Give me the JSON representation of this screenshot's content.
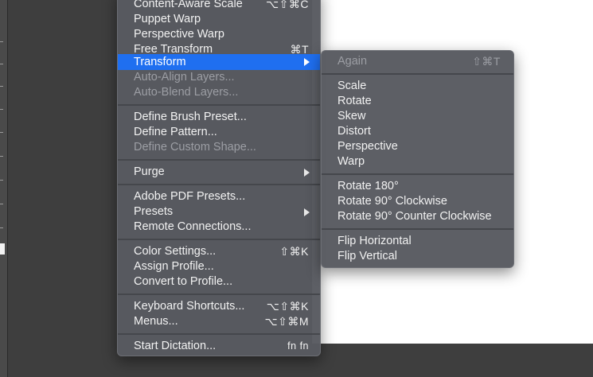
{
  "main_menu": {
    "items": [
      {
        "label": "Content-Aware Scale",
        "shortcut": "⌥⇧⌘C"
      },
      {
        "label": "Puppet Warp",
        "shortcut": ""
      },
      {
        "label": "Perspective Warp",
        "shortcut": ""
      },
      {
        "label": "Free Transform",
        "shortcut": "⌘T"
      },
      {
        "label": "Transform",
        "shortcut": "",
        "submenu": true,
        "highlighted": true
      },
      {
        "label": "Auto-Align Layers...",
        "shortcut": "",
        "disabled": true
      },
      {
        "label": "Auto-Blend Layers...",
        "shortcut": "",
        "disabled": true
      },
      {
        "label": "Define Brush Preset...",
        "shortcut": ""
      },
      {
        "label": "Define Pattern...",
        "shortcut": ""
      },
      {
        "label": "Define Custom Shape...",
        "shortcut": "",
        "disabled": true
      },
      {
        "label": "Purge",
        "shortcut": "",
        "submenu": true
      },
      {
        "label": "Adobe PDF Presets...",
        "shortcut": ""
      },
      {
        "label": "Presets",
        "shortcut": "",
        "submenu": true
      },
      {
        "label": "Remote Connections...",
        "shortcut": ""
      },
      {
        "label": "Color Settings...",
        "shortcut": "⇧⌘K"
      },
      {
        "label": "Assign Profile...",
        "shortcut": ""
      },
      {
        "label": "Convert to Profile...",
        "shortcut": ""
      },
      {
        "label": "Keyboard Shortcuts...",
        "shortcut": "⌥⇧⌘K"
      },
      {
        "label": "Menus...",
        "shortcut": "⌥⇧⌘M"
      },
      {
        "label": "Start Dictation...",
        "shortcut": "fn fn"
      }
    ]
  },
  "transform_submenu": {
    "items": [
      {
        "label": "Again",
        "shortcut": "⇧⌘T",
        "disabled": true
      },
      {
        "label": "Scale",
        "shortcut": ""
      },
      {
        "label": "Rotate",
        "shortcut": ""
      },
      {
        "label": "Skew",
        "shortcut": ""
      },
      {
        "label": "Distort",
        "shortcut": ""
      },
      {
        "label": "Perspective",
        "shortcut": ""
      },
      {
        "label": "Warp",
        "shortcut": ""
      },
      {
        "label": "Rotate 180°",
        "shortcut": ""
      },
      {
        "label": "Rotate 90° Clockwise",
        "shortcut": ""
      },
      {
        "label": "Rotate 90° Counter Clockwise",
        "shortcut": ""
      },
      {
        "label": "Flip Horizontal",
        "shortcut": ""
      },
      {
        "label": "Flip Vertical",
        "shortcut": ""
      }
    ]
  },
  "colors": {
    "highlight": "#1f6ff0",
    "menu_bg": "#585a60",
    "disabled_text": "#9c9ea4",
    "canvas": "#ffffff"
  }
}
